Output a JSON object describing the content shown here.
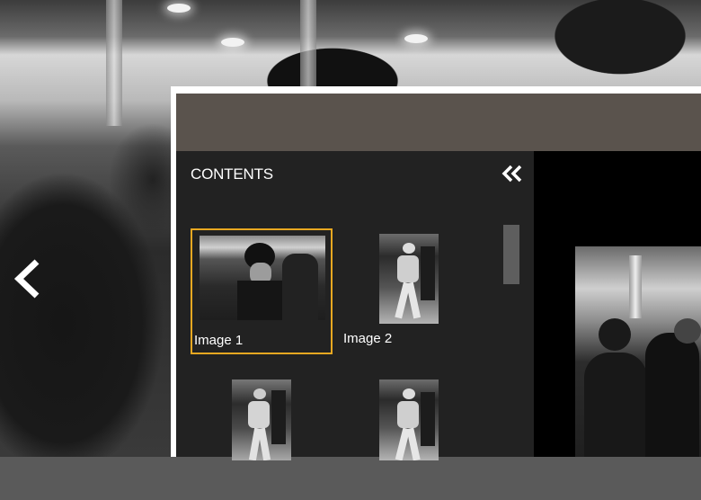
{
  "navigation": {
    "prev_icon": "chevron-left-icon"
  },
  "panel": {
    "title": "CONTENTS",
    "collapse_icon": "double-chevron-left-icon",
    "accent_color": "#e8a821",
    "items": [
      {
        "label": "Image 1",
        "selected": true
      },
      {
        "label": "Image 2",
        "selected": false
      },
      {
        "label": "",
        "selected": false
      },
      {
        "label": "",
        "selected": false
      }
    ]
  }
}
